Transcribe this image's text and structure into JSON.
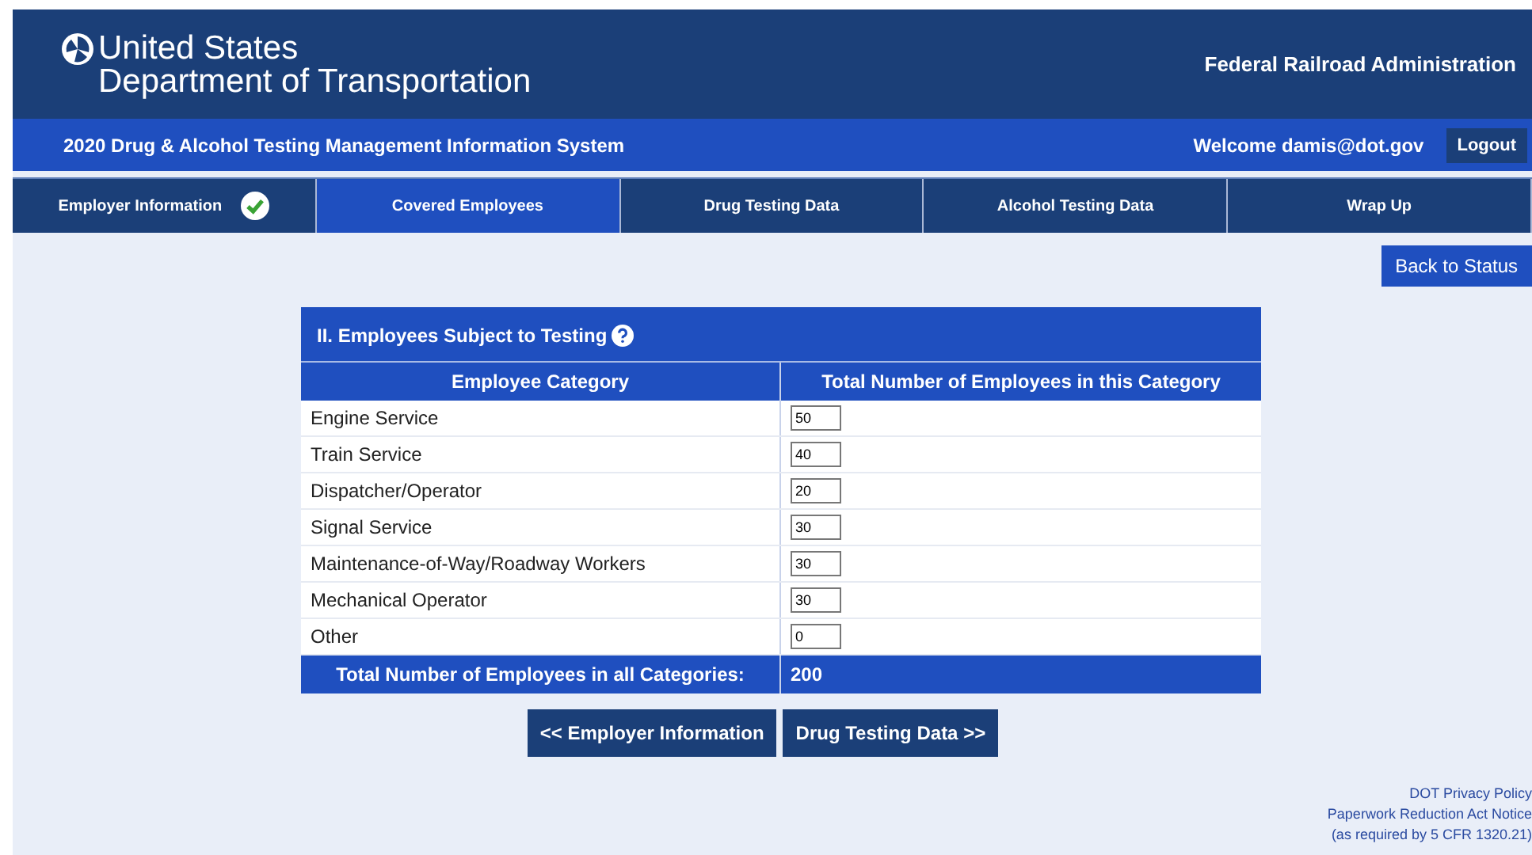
{
  "header": {
    "title_line1": "United States",
    "title_line2": "Department of Transportation",
    "agency": "Federal Railroad Administration"
  },
  "system_bar": {
    "title": "2020 Drug & Alcohol Testing Management Information System",
    "welcome": "Welcome damis@dot.gov",
    "logout": "Logout"
  },
  "tabs": [
    {
      "label": "Employer Information",
      "selected": false,
      "completed": true
    },
    {
      "label": "Covered Employees",
      "selected": true,
      "completed": false
    },
    {
      "label": "Drug Testing Data",
      "selected": false,
      "completed": false
    },
    {
      "label": "Alcohol Testing Data",
      "selected": false,
      "completed": false
    },
    {
      "label": "Wrap Up",
      "selected": false,
      "completed": false
    }
  ],
  "back_button": "Back to Status",
  "section": {
    "title": "II. Employees Subject to Testing",
    "columns": [
      "Employee Category",
      "Total Number of Employees in this Category"
    ],
    "rows": [
      {
        "category": "Engine Service",
        "value": "50"
      },
      {
        "category": "Train Service",
        "value": "40"
      },
      {
        "category": "Dispatcher/Operator",
        "value": "20"
      },
      {
        "category": "Signal Service",
        "value": "30"
      },
      {
        "category": "Maintenance-of-Way/Roadway Workers",
        "value": "30"
      },
      {
        "category": "Mechanical Operator",
        "value": "30"
      },
      {
        "category": "Other",
        "value": "0"
      }
    ],
    "total_label": "Total Number of Employees in all Categories:",
    "total_value": "200"
  },
  "nav_buttons": [
    "<< Employer Information",
    "Drug Testing Data >>"
  ],
  "footer": [
    "DOT Privacy Policy",
    "Paperwork Reduction Act Notice",
    "(as required by 5 CFR 1320.21)"
  ]
}
